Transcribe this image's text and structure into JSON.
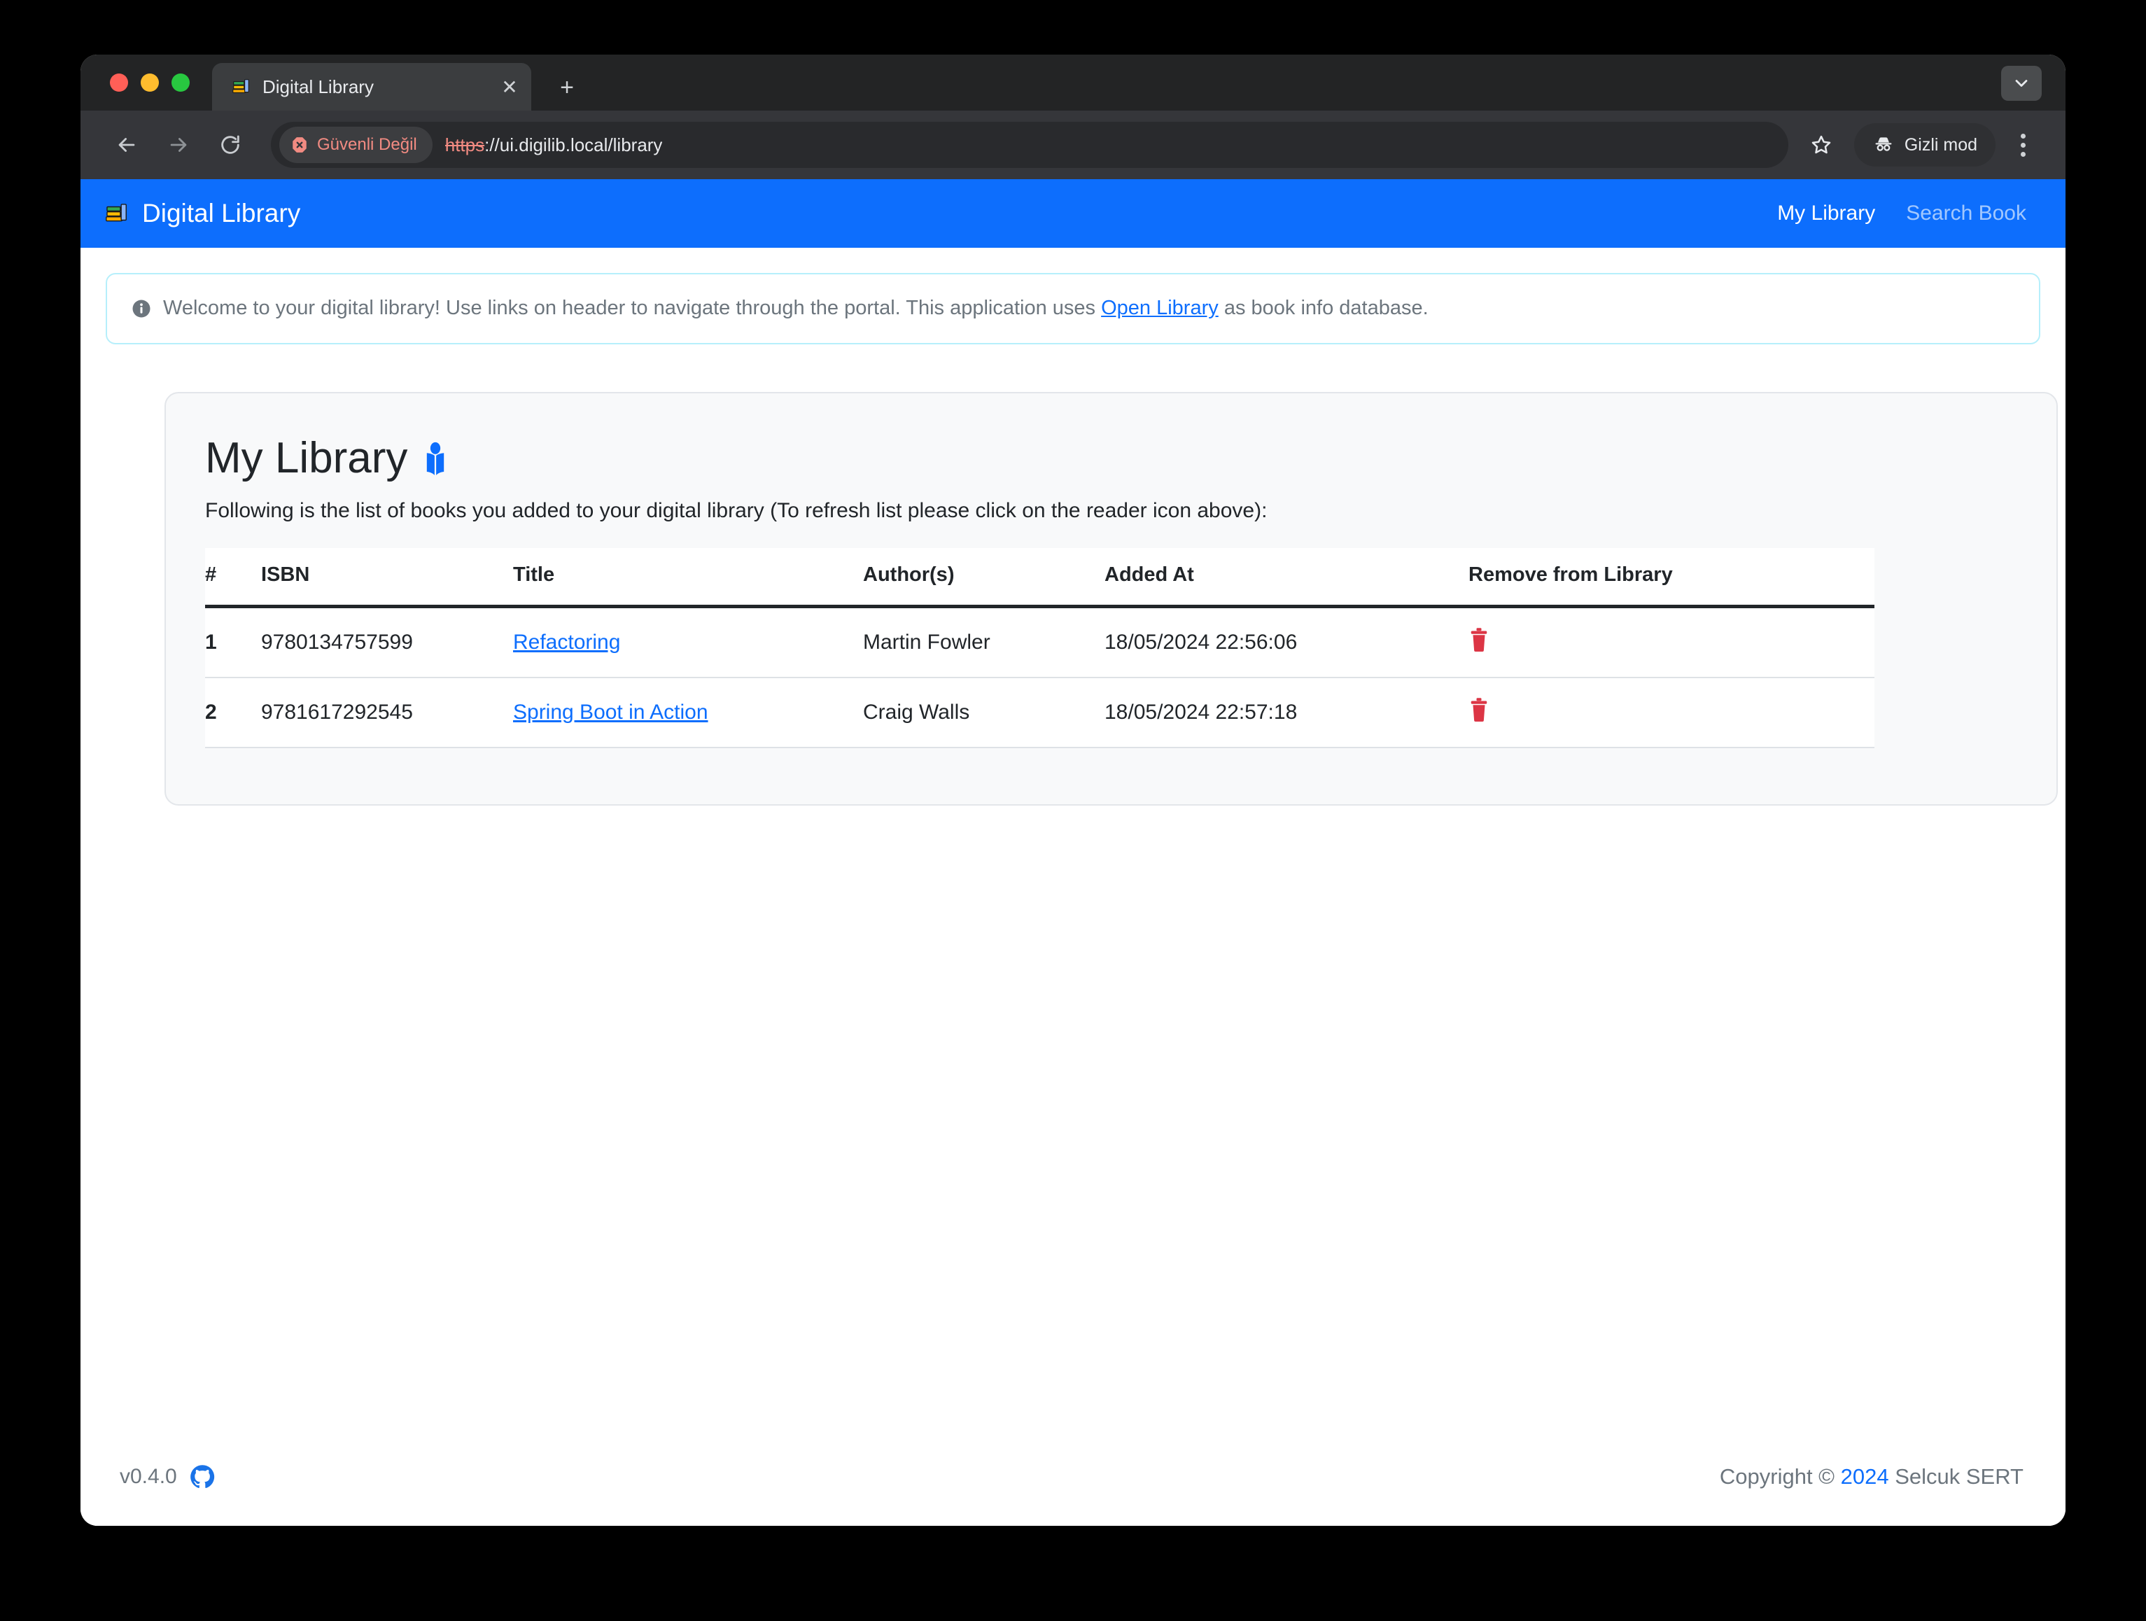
{
  "browser": {
    "tab": {
      "title": "Digital Library",
      "favicon": "books-icon",
      "close_label": "✕"
    },
    "new_tab_label": "+",
    "toolbar": {
      "back_icon": "back-arrow-icon",
      "forward_icon": "forward-arrow-icon",
      "reload_icon": "reload-icon",
      "security_badge": "Güvenli Değil",
      "url_scheme": "https",
      "url_rest": "://ui.digilib.local/library",
      "bookmark_icon": "star-icon",
      "incognito_label": "Gizli mod",
      "menu_icon": "kebab-menu-icon"
    },
    "colors": {
      "tabstrip": "#232425",
      "toolbar": "#35363a",
      "danger_text": "#f28b82"
    }
  },
  "appbar": {
    "brand": "Digital Library",
    "brand_icon": "books-icon",
    "links": [
      {
        "label": "My Library",
        "active": true
      },
      {
        "label": "Search Book",
        "active": false
      }
    ],
    "accent": "#0d6efd"
  },
  "alert": {
    "icon": "info-circle-icon",
    "text_before": "Welcome to your digital library! Use links on header to navigate through the portal. This application uses ",
    "link_label": "Open Library",
    "text_after": " as book info database."
  },
  "card": {
    "title": "My Library",
    "title_icon": "reader-icon",
    "description": "Following is the list of books you added to your digital library (To refresh list please click on the reader icon above):",
    "table": {
      "columns": [
        "#",
        "ISBN",
        "Title",
        "Author(s)",
        "Added At",
        "Remove from Library"
      ],
      "rows": [
        {
          "index": "1",
          "isbn": "9780134757599",
          "title": "Refactoring",
          "authors": "Martin Fowler",
          "added_at": "18/05/2024 22:56:06",
          "remove_icon": "trash-icon"
        },
        {
          "index": "2",
          "isbn": "9781617292545",
          "title": "Spring Boot in Action",
          "authors": "Craig Walls",
          "added_at": "18/05/2024 22:57:18",
          "remove_icon": "trash-icon"
        }
      ]
    }
  },
  "footer": {
    "version": "v0.4.0",
    "github_icon": "github-icon",
    "copyright_prefix": "Copyright © ",
    "year": "2024",
    "copyright_suffix": " Selcuk SERT"
  }
}
